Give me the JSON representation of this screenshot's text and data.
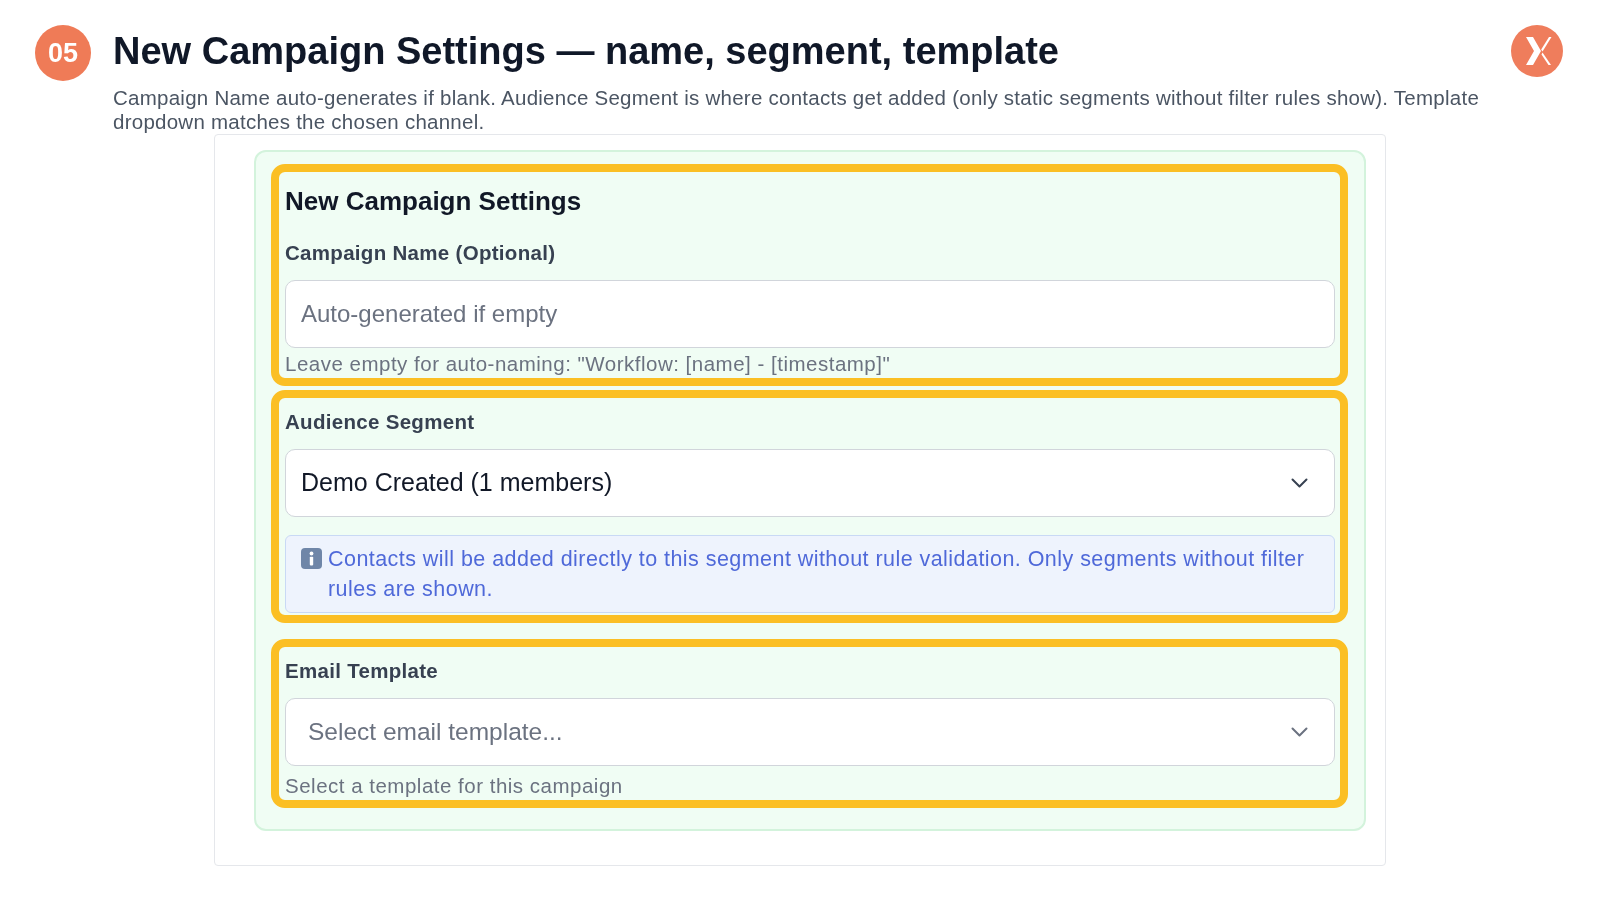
{
  "header": {
    "step_badge": "05",
    "title": "New Campaign Settings — name, segment, template",
    "description": "Campaign Name auto-generates if blank. Audience Segment is where contacts get added (only static segments without filter rules show). Template dropdown matches the chosen channel."
  },
  "form": {
    "groups": [
      {
        "highlighted": true,
        "items": [
          {
            "kind": "heading",
            "text": "New Campaign Settings"
          },
          {
            "kind": "text_input",
            "label": "Campaign Name (Optional)",
            "placeholder": "Auto-generated if empty",
            "hint": "Leave empty for auto-naming: \"Workflow: [name] - [timestamp]\""
          }
        ]
      },
      {
        "highlighted": true,
        "items": [
          {
            "kind": "select",
            "label": "Audience Segment",
            "value": "Demo Created (1 members)",
            "info": "Contacts will be added directly to this segment without rule validation. Only segments without filter rules are shown."
          }
        ]
      },
      {
        "highlighted": true,
        "items": [
          {
            "kind": "select",
            "label": "Email Template",
            "placeholder": "Select email template...",
            "hint": "Select a template for this campaign"
          }
        ]
      }
    ]
  }
}
